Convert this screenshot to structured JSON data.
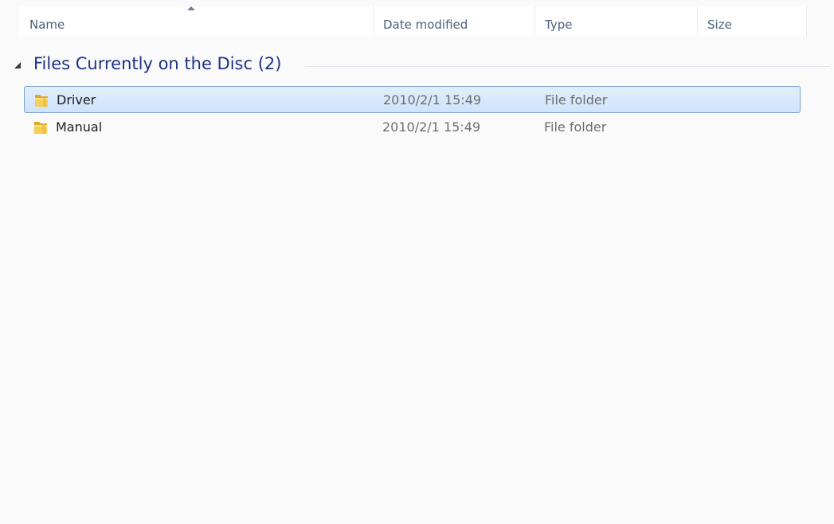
{
  "columns": {
    "name": "Name",
    "date": "Date modified",
    "type": "Type",
    "size": "Size"
  },
  "group": {
    "title": "Files Currently on the Disc (2)"
  },
  "files": [
    {
      "name": "Driver",
      "date": "2010/2/1 15:49",
      "type": "File folder",
      "size": "",
      "icon": "folder-icon",
      "selected": true
    },
    {
      "name": "Manual",
      "date": "2010/2/1 15:49",
      "type": "File folder",
      "size": "",
      "icon": "folder-icon",
      "selected": false
    }
  ],
  "colors": {
    "background": "#fafafa",
    "group_title": "#1e3287",
    "selection_border": "#7da2ce"
  }
}
